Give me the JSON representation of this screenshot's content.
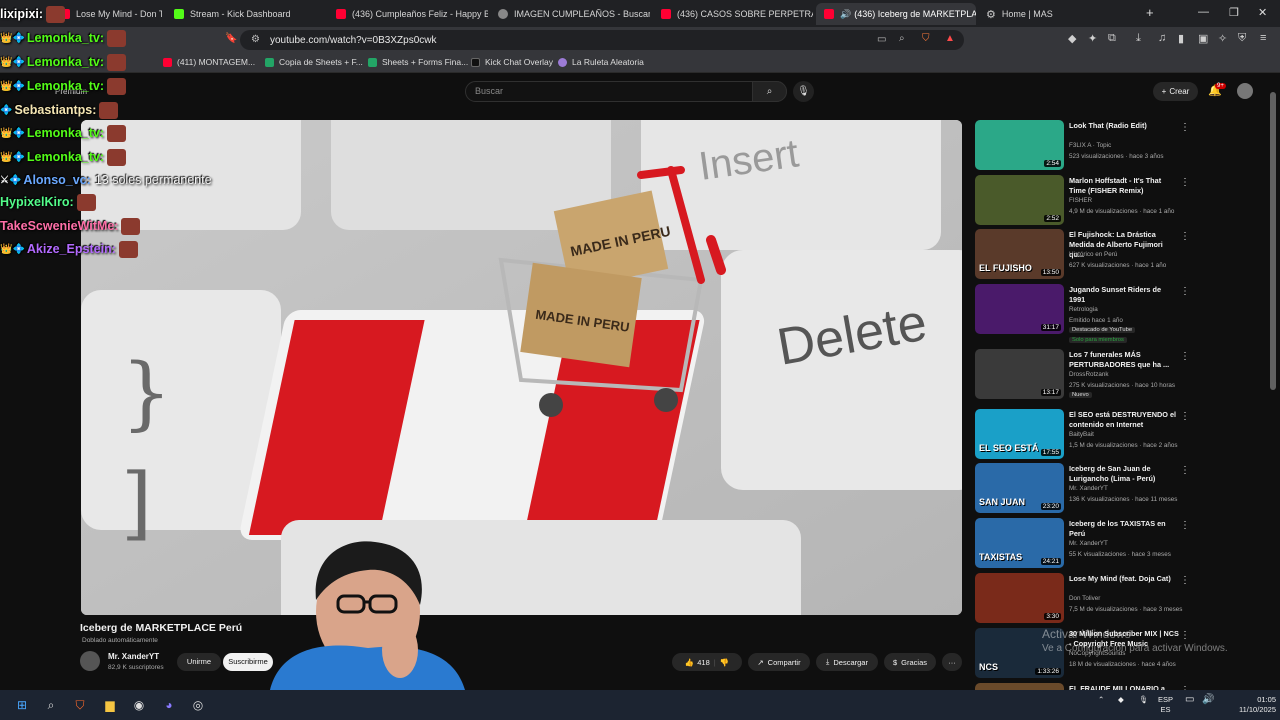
{
  "browser": {
    "tabs": [
      {
        "title": "Lose My Mind - Don Toliver (fe",
        "favicon": "youtube"
      },
      {
        "title": "Stream - Kick Dashboard",
        "favicon": "kick"
      },
      {
        "title": "(436) Cumpleaños Feliz - Happy Birt",
        "favicon": "youtube"
      },
      {
        "title": "IMAGEN CUMPLEAÑOS - Buscar co",
        "favicon": "google"
      },
      {
        "title": "(436) CASOS SOBRE PERPETRADOR",
        "favicon": "youtube"
      },
      {
        "title": "(436) Iceberg de MARKETPLA",
        "favicon": "youtube",
        "active": true
      },
      {
        "title": "Home | MAS",
        "favicon": "gear"
      }
    ],
    "new_tab_glyph": "+",
    "url": "youtube.com/watch?v=0B3XZps0cwk",
    "bookmarks": [
      {
        "label": "(411) MONTAGEM...",
        "color": "#ff0033"
      },
      {
        "label": "Copia de Sheets + F...",
        "color": "#23a566"
      },
      {
        "label": "Sheets + Forms Fina...",
        "color": "#23a566"
      },
      {
        "label": "Kick Chat Overlay",
        "color": "#111111"
      },
      {
        "label": "La Ruleta Aleatoria",
        "color": "#9c7bd6"
      }
    ],
    "premium_label": "Premium"
  },
  "youtube": {
    "search_placeholder": "Buscar",
    "create_label": "Crear",
    "notif_count": "9+",
    "video": {
      "title": "Iceberg de MARKETPLACE Perú",
      "dub_note": "Doblado automáticamente",
      "channel": "Mr. XanderYT",
      "subscribers": "82,9 K suscriptores",
      "join_label": "Unirme",
      "subscribe_label": "Suscribirme",
      "likes": "418",
      "share_label": "Compartir",
      "download_label": "Descargar",
      "thanks_label": "Gracias",
      "more_glyph": "···",
      "thumb_text": {
        "box_top": "MADE IN PERU",
        "box_bottom": "MADE IN PERU",
        "key": "Delete",
        "key2": "Insert"
      }
    },
    "sidebar": [
      {
        "title": "Look That (Radio Edit)",
        "channel": "F3LIX A · Topic",
        "meta": "523 visualizaciones · hace 3 años",
        "duration": "2:54",
        "thumb": "#2ba888"
      },
      {
        "title": "Marlon Hoffstadt - It's That Time (FISHER Remix)",
        "channel": "FISHER",
        "meta": "4,9 M de visualizaciones · hace 1 año",
        "duration": "2:52",
        "thumb": "#4a5a2a"
      },
      {
        "title": "El Fujishock: La Drástica Medida de Alberto Fujimori qu...",
        "channel": "Histórico en Perú",
        "meta": "627 K visualizaciones · hace 1 año",
        "duration": "13:50",
        "thumb": "#5a3a2a",
        "thumb_text": "EL FUJISHO"
      },
      {
        "title": "Jugando Sunset Riders de 1991",
        "channel": "Retrologia",
        "meta": "Emitido hace 1 año",
        "badge": "Destacado de YouTube",
        "extra": "Solo para miembros",
        "duration": "31:17",
        "thumb": "#4a1a6a"
      },
      {
        "title": "Los 7 funerales MÁS PERTURBADORES que ha ...",
        "channel": "DrossRotzank",
        "meta": "275 K visualizaciones · hace 10 horas",
        "badge": "Nuevo",
        "duration": "13:17",
        "thumb": "#3a3a3a"
      },
      {
        "title": "El SEO está DESTRUYENDO el contenido en Internet",
        "channel": "BaityBait",
        "meta": "1,5 M de visualizaciones · hace 2 años",
        "duration": "17:55",
        "thumb": "#1aa0c8",
        "thumb_text": "EL SEO ESTÁ"
      },
      {
        "title": "Iceberg de San Juan de Lurigancho (Lima - Perú)",
        "channel": "Mr. XanderYT",
        "meta": "136 K visualizaciones · hace 11 meses",
        "duration": "23:20",
        "thumb": "#2a6aa8",
        "thumb_text": "SAN JUAN"
      },
      {
        "title": "Iceberg de los TAXISTAS en Perú",
        "channel": "Mr. XanderYT",
        "meta": "55 K visualizaciones · hace 3 meses",
        "duration": "24:21",
        "thumb": "#2a6aa8",
        "thumb_text": "TAXISTAS"
      },
      {
        "title": "Lose My Mind (feat. Doja Cat)",
        "channel": "Don Toliver",
        "meta": "7,5 M de visualizaciones · hace 3 meses",
        "duration": "3:30",
        "thumb": "#7a2a1a"
      },
      {
        "title": "30 Million Subscriber MIX | NCS - Copyright Free Music",
        "channel": "NoCopyrightSounds",
        "meta": "18 M de visualizaciones · hace 4 años",
        "duration": "1:33:26",
        "thumb": "#1a2a3a",
        "thumb_text": "NCS"
      },
      {
        "title": "EL FRAUDE MILLONARIO a KICK",
        "channel": "",
        "meta": "",
        "duration": "",
        "thumb": "#6a4a2a"
      }
    ]
  },
  "chat_overlay": [
    {
      "user": "lixipixi:",
      "color": "#ffffff",
      "icons": "",
      "emote": true,
      "msg": ""
    },
    {
      "user": "Lemonka_tv:",
      "color": "#53fc18",
      "icons": "👑💠",
      "emote": true,
      "msg": ""
    },
    {
      "user": "Lemonka_tv:",
      "color": "#53fc18",
      "icons": "👑💠",
      "emote": true,
      "msg": ""
    },
    {
      "user": "Lemonka_tv:",
      "color": "#53fc18",
      "icons": "👑💠",
      "emote": true,
      "msg": ""
    },
    {
      "user": "Sebastiantps:",
      "color": "#f5e6b3",
      "icons": "💠",
      "emote": true,
      "msg": ""
    },
    {
      "user": "Lemonka_tv:",
      "color": "#53fc18",
      "icons": "👑💠",
      "emote": true,
      "msg": ""
    },
    {
      "user": "Lemonka_tv:",
      "color": "#53fc18",
      "icons": "👑💠",
      "emote": true,
      "msg": ""
    },
    {
      "user": "Alonso_vc:",
      "color": "#6aa8ff",
      "icons": "⚔💠",
      "emote": false,
      "msg": "13 soles permanente"
    },
    {
      "user": "HypixelKiro:",
      "color": "#53fc8a",
      "icons": "",
      "emote": true,
      "msg": ""
    },
    {
      "user": "TakeScwenieWitMe:",
      "color": "#ff6fa8",
      "icons": "",
      "emote": true,
      "msg": ""
    },
    {
      "user": "Akize_Epstein:",
      "color": "#b36aff",
      "icons": "👑💠",
      "emote": true,
      "msg": ""
    }
  ],
  "windows": {
    "activate_title": "Activar Windows",
    "activate_sub": "Ve a Configuración para activar Windows.",
    "lang": "ESP",
    "lang2": "ES",
    "time": "01:05",
    "date": "11/10/2025"
  }
}
